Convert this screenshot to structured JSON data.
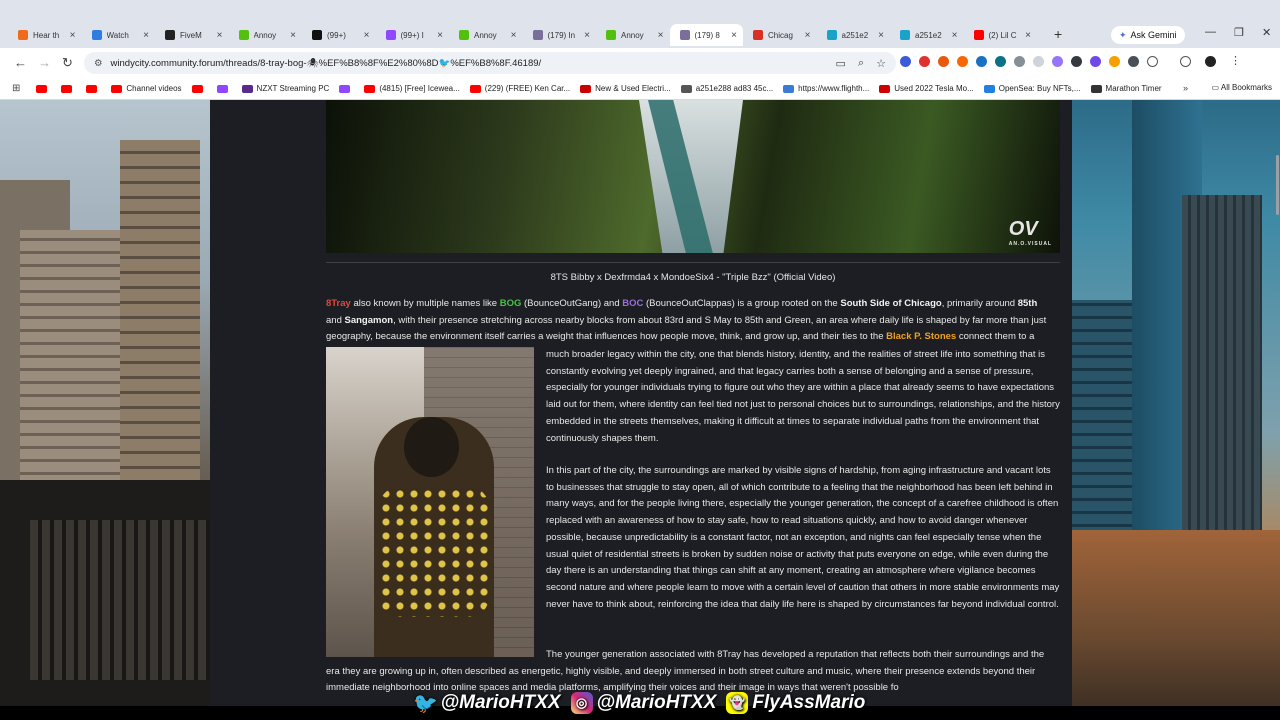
{
  "browser": {
    "tabs": [
      {
        "label": "Hear th",
        "icon": "audio-icon",
        "color": "#f06a1b"
      },
      {
        "label": "Watch",
        "icon": "watch-icon",
        "color": "#2f7de1"
      },
      {
        "label": "FiveM",
        "icon": "fivem-icon",
        "color": "#222222"
      },
      {
        "label": "Annoy",
        "icon": "kick-icon",
        "color": "#53c00f"
      },
      {
        "label": "(99+)",
        "icon": "tiktok-icon",
        "color": "#111111"
      },
      {
        "label": "(99+) I",
        "icon": "twitch-icon",
        "color": "#9146ff"
      },
      {
        "label": "Annoy",
        "icon": "kick-icon",
        "color": "#53c00f"
      },
      {
        "label": "(179) In",
        "icon": "forum-icon",
        "color": "#7a6f9a"
      },
      {
        "label": "Annoy",
        "icon": "kick-icon",
        "color": "#53c00f"
      },
      {
        "label": "(179) 8",
        "icon": "forum-icon",
        "color": "#7a6f9a"
      },
      {
        "label": "Chicag",
        "icon": "chicago-icon",
        "color": "#d93025"
      },
      {
        "label": "a251e2",
        "icon": "opensea-icon",
        "color": "#1aa3c8"
      },
      {
        "label": "a251e2",
        "icon": "opensea-icon",
        "color": "#1aa3c8"
      },
      {
        "label": "(2) Lil C",
        "icon": "youtube-icon",
        "color": "#ff0000"
      }
    ],
    "active_tab_index": 9,
    "ask_gemini": "Ask Gemini",
    "url": "windycity.community.forum/threads/8-tray-bog-🕷%EF%B8%8F%E2%80%8D🐦%EF%B8%8F.46189/",
    "bookmarks": [
      {
        "label": "",
        "icon": "youtube-icon"
      },
      {
        "label": "",
        "icon": "youtube-icon"
      },
      {
        "label": "",
        "icon": "youtube-icon"
      },
      {
        "label": "Channel videos",
        "icon": "youtube-icon"
      },
      {
        "label": "",
        "icon": "youtube-icon"
      },
      {
        "label": "",
        "icon": "twitch-icon"
      },
      {
        "label": "NZXT Streaming PC",
        "icon": "nzxt-icon"
      },
      {
        "label": "",
        "icon": "twitch-icon"
      },
      {
        "label": "(4815) [Free] Icewea...",
        "icon": "youtube-icon"
      },
      {
        "label": "(229) (FREE) Ken Car...",
        "icon": "youtube-icon"
      },
      {
        "label": "New & Used Electri...",
        "icon": "tesla-icon"
      },
      {
        "label": "a251e288 ad83 45c...",
        "icon": "globe-icon"
      },
      {
        "label": "https://www.flighth...",
        "icon": "flight-icon"
      },
      {
        "label": "Used 2022 Tesla Mo...",
        "icon": "tesla-icon"
      },
      {
        "label": "OpenSea: Buy NFTs,...",
        "icon": "opensea-icon"
      },
      {
        "label": "Marathon Timer",
        "icon": "timer-icon"
      }
    ],
    "all_bookmarks": "All Bookmarks"
  },
  "post": {
    "caption": "8TS Bibby x Dexfrmda4 x MondoeSix4 - \"Triple Bzz\" (Official Video)",
    "watermark": "OV",
    "watermark_sub": "AN.O.VISUAL",
    "intro": {
      "t1": "8Tray",
      "t2": " also known by multiple names like ",
      "t3": "BOG",
      "t4": " (BounceOutGang) and ",
      "t5": "BOC",
      "t6": " (BounceOutClappas) is a group rooted on the ",
      "t7": "South Side of Chicago",
      "t8": ", primarily around ",
      "t9": "85th",
      "t10": " and ",
      "t11": "Sangamon",
      "t12": ", with their presence stretching across nearby blocks from about 83rd and S May to 85th and Green, an area where daily life is shaped by far more than just geography, because the environment itself carries a weight that influences how people move, think, and grow up, and their ties to the ",
      "t13": "Black P. Stones",
      "t14": " connect them to a"
    },
    "wrap": "much broader legacy within the city, one that blends history, identity, and the realities of street life into something that is constantly evolving yet deeply ingrained, and that legacy carries both a sense of belonging and a sense of pressure, especially for younger individuals trying to figure out who they are within a place that already seems to have expectations laid out for them, where identity can feel tied not just to personal choices but to surroundings, relationships, and the history embedded in the streets themselves, making it difficult at times to separate individual paths from the environment that continuously shapes them.",
    "para2": "In this part of the city, the surroundings are marked by visible signs of hardship, from aging infrastructure and vacant lots to businesses that struggle to stay open, all of which contribute to a feeling that the neighborhood has been left behind in many ways, and for the people living there, especially the younger generation, the concept of a carefree childhood is often replaced with an awareness of how to stay safe, how to read situations quickly, and how to avoid danger whenever possible, because unpredictability is a constant factor, not an exception, and nights can feel especially tense when the usual quiet of residential streets is broken by sudden noise or activity that puts everyone on edge, while even during the day there is an understanding that things can shift at any moment, creating an atmosphere where vigilance becomes second nature and where people learn to move with a certain level of caution that others in more stable environments may never have to think about, reinforcing the idea that daily life here is shaped by circumstances far beyond individual control.",
    "para3": "The younger generation associated with 8Tray has developed a reputation that reflects both their surroundings and the era they are growing up in, often described as energetic, highly visible, and deeply immersed in both street culture and music, where their presence extends beyond their immediate neighborhood into online spaces and media platforms, amplifying their voices and their image in ways that weren't possible fo"
  },
  "overlay": {
    "twitter": "@MarioHTXX",
    "instagram": "@MarioHTXX",
    "snapchat": "FlyAssMario"
  }
}
